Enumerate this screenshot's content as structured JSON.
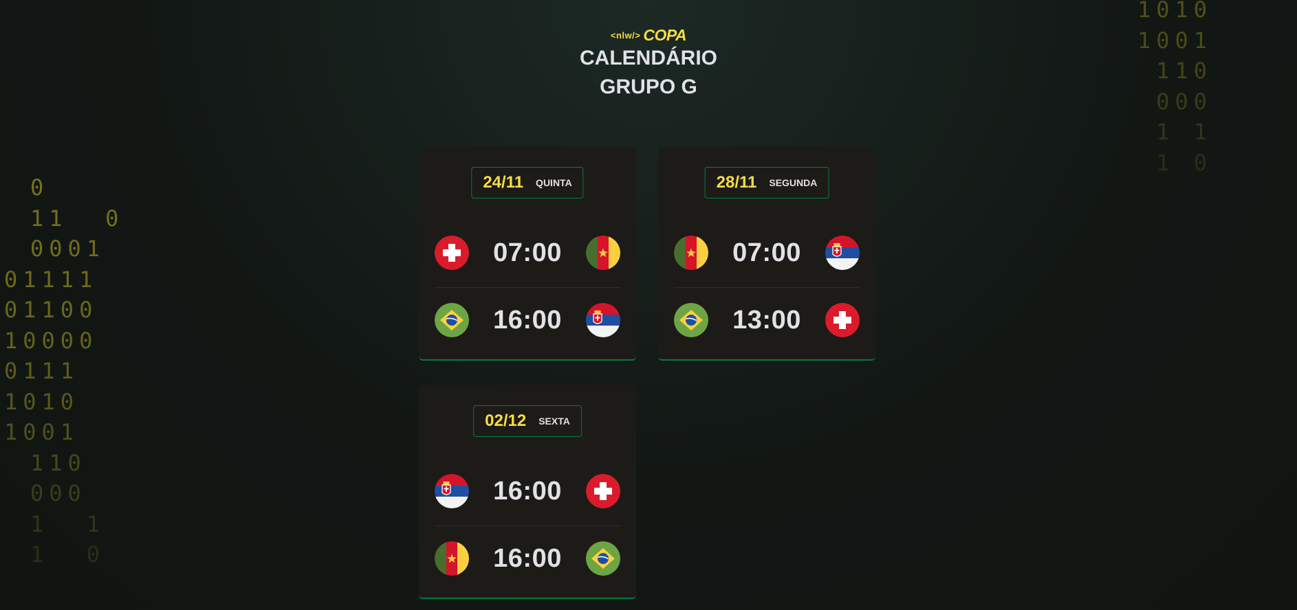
{
  "header": {
    "logo_tag": "<nlw/>",
    "logo_word": "COPA",
    "title_line1": "CALENDÁRIO",
    "title_line2": "GRUPO G"
  },
  "colors": {
    "accent_yellow": "#f7dd43",
    "accent_green": "#047c3f",
    "card_bg": "#1d1b18"
  },
  "decor": {
    "binary_left": [
      "0",
      "11  0",
      "0001",
      "01111",
      "01100",
      "10000",
      "0111",
      "1010",
      "1001",
      "110",
      "000",
      "1  1",
      "1  0"
    ],
    "binary_right": [
      "1010",
      "1001",
      " 110",
      " 000",
      " 1 1",
      " 1 0"
    ]
  },
  "cards": [
    {
      "date": "24/11",
      "weekday": "QUINTA",
      "matches": [
        {
          "home": "switzerland-flag-icon",
          "time": "07:00",
          "away": "cameroon-flag-icon"
        },
        {
          "home": "brazil-flag-icon",
          "time": "16:00",
          "away": "serbia-flag-icon"
        }
      ]
    },
    {
      "date": "28/11",
      "weekday": "SEGUNDA",
      "matches": [
        {
          "home": "cameroon-flag-icon",
          "time": "07:00",
          "away": "serbia-flag-icon"
        },
        {
          "home": "brazil-flag-icon",
          "time": "13:00",
          "away": "switzerland-flag-icon"
        }
      ]
    },
    {
      "date": "02/12",
      "weekday": "SEXTA",
      "matches": [
        {
          "home": "serbia-flag-icon",
          "time": "16:00",
          "away": "switzerland-flag-icon"
        },
        {
          "home": "cameroon-flag-icon",
          "time": "16:00",
          "away": "brazil-flag-icon"
        }
      ]
    }
  ]
}
